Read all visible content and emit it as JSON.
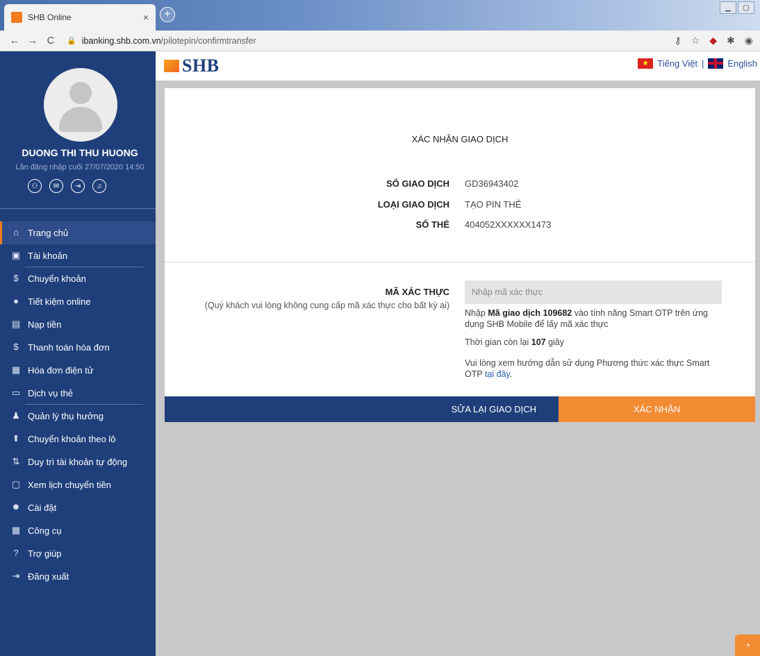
{
  "browser": {
    "tab_title": "SHB Online",
    "tab_close": "×",
    "new_tab": "+",
    "url_host": "ibanking.shb.com.vn",
    "url_path": "/pilotepin/confirmtransfer",
    "back": "←",
    "forward": "→",
    "reload": "C"
  },
  "sidebar": {
    "username": "DUONG THI THU HUONG",
    "last_login": "Lần đăng nhập cuối 27/07/2020 14:50",
    "items": [
      {
        "label": "Trang chủ",
        "icon": "home-icon",
        "glyph": "⌂"
      },
      {
        "label": "Tài khoản",
        "icon": "account-icon",
        "glyph": "▣"
      },
      {
        "label": "Chuyển khoản",
        "icon": "transfer-icon",
        "glyph": "$"
      },
      {
        "label": "Tiết kiệm online",
        "icon": "piggy-bank-icon",
        "glyph": "●"
      },
      {
        "label": "Nạp tiền",
        "icon": "topup-icon",
        "glyph": "▤"
      },
      {
        "label": "Thanh toán hóa đơn",
        "icon": "bill-icon",
        "glyph": "$"
      },
      {
        "label": "Hóa đơn điện tử",
        "icon": "e-invoice-icon",
        "glyph": "▦"
      },
      {
        "label": "Dịch vụ thẻ",
        "icon": "card-icon",
        "glyph": "▭"
      },
      {
        "label": "Quản lý thụ hưởng",
        "icon": "beneficiary-icon",
        "glyph": "♟"
      },
      {
        "label": "Chuyển khoản theo lô",
        "icon": "batch-upload-icon",
        "glyph": "⬆"
      },
      {
        "label": "Duy trì tài khoản tự động",
        "icon": "auto-maintain-icon",
        "glyph": "⇅"
      },
      {
        "label": "Xem lịch chuyển tiền",
        "icon": "calendar-icon",
        "glyph": "▢"
      },
      {
        "label": "Cài đặt",
        "icon": "gear-icon",
        "glyph": "✹"
      },
      {
        "label": "Công cụ",
        "icon": "calculator-icon",
        "glyph": "▦"
      },
      {
        "label": "Trợ giúp",
        "icon": "help-icon",
        "glyph": "?"
      },
      {
        "label": "Đăng xuất",
        "icon": "logout-icon",
        "glyph": "⇥"
      }
    ]
  },
  "header": {
    "logo_text": "SHB",
    "lang_vi": "Tiếng Việt",
    "lang_sep": "|",
    "lang_en": "English"
  },
  "confirm": {
    "title": "XÁC NHẬN GIAO DỊCH",
    "txn_no_label": "SỐ GIAO DỊCH",
    "txn_no_value": "GD36943402",
    "txn_type_label": "LOẠI GIAO DỊCH",
    "txn_type_value": "TẠO PIN THẺ",
    "card_no_label": "SỐ THẺ",
    "card_no_value": "404052XXXXXX1473",
    "otp_label": "MÃ XÁC THỰC",
    "otp_note": "(Quý khách vui lòng không cung cấp mã xác thực cho bất kỳ ai)",
    "otp_placeholder": "Nhập mã xác thực",
    "info1_pre": "Nhập ",
    "info1_bold": "Mã giao dịch 109682",
    "info1_post": " vào tính năng Smart OTP trên ứng dụng SHB Mobile để lấy mã xác thực",
    "info2_pre": "Thời gian còn lại ",
    "info2_bold": "107",
    "info2_post": " giây",
    "info3_pre": "Vui lòng xem hướng dẫn sử dụng Phương thức xác thực Smart OTP ",
    "info3_link": "tại đây",
    "info3_post": ".",
    "back_button": "SỬA LẠI GIAO DỊCH",
    "confirm_button": "XÁC NHẬN"
  },
  "colors": {
    "sidebar_bg": "#1f3f7b",
    "accent_orange": "#f38b33",
    "page_bg": "#c8c8c8"
  }
}
